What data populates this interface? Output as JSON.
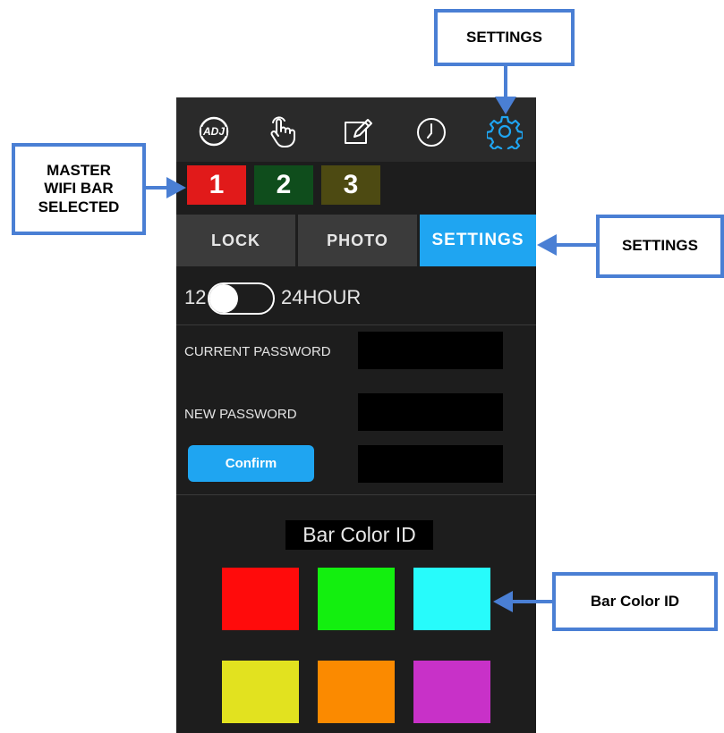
{
  "top_nav": {
    "items": [
      {
        "icon": "adj-logo-icon",
        "label": "ADJ"
      },
      {
        "icon": "touch-hand-icon"
      },
      {
        "icon": "edit-icon"
      },
      {
        "icon": "clock-icon"
      },
      {
        "icon": "gear-icon",
        "color": "#1fa5f1"
      }
    ]
  },
  "bars": [
    {
      "label": "1",
      "color": "#e11a1a"
    },
    {
      "label": "2",
      "color": "#0f4d1c"
    },
    {
      "label": "3",
      "color": "#4d4a12"
    }
  ],
  "tabs": [
    {
      "label": "LOCK"
    },
    {
      "label": "PHOTO"
    },
    {
      "label": "SETTINGS",
      "active": true
    }
  ],
  "time_format": {
    "left": "12",
    "right": "24HOUR"
  },
  "password": {
    "current_label": "CURRENT PASSWORD",
    "new_label": "NEW PASSWORD",
    "confirm_label": "Confirm"
  },
  "bar_color": {
    "title": "Bar Color ID",
    "swatches": [
      "#ff0b0b",
      "#13ef0f",
      "#27fbfb",
      "#e2e21f",
      "#fb8a00",
      "#c831c8"
    ]
  },
  "annotations": {
    "settings_top": "SETTINGS",
    "master": "MASTER WIFI BAR SELECTED",
    "master_lines": [
      "MASTER",
      "WIFI BAR",
      "SELECTED"
    ],
    "settings_tab": "SETTINGS",
    "bar_color": "Bar Color ID"
  },
  "accent_color": "#1fa5f1",
  "callout_border_color": "#4a7fd4"
}
